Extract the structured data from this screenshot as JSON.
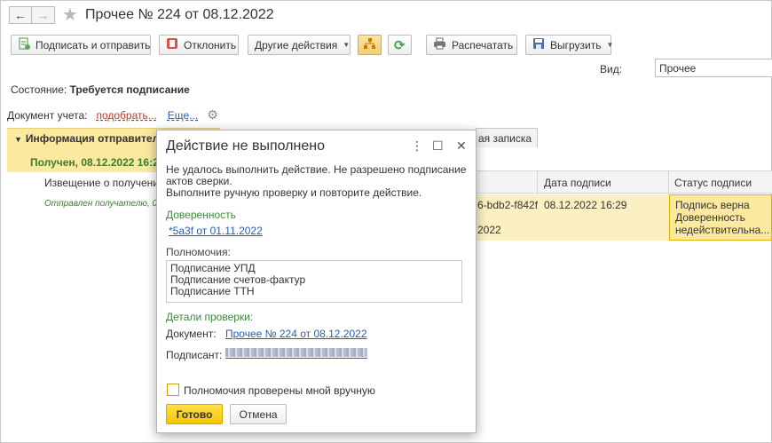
{
  "window": {
    "title": "Прочее № 224 от 08.12.2022",
    "nav_back": "←",
    "nav_forward": "→"
  },
  "toolbar": {
    "sign_send": "Подписать и отправить",
    "reject": "Отклонить",
    "other_actions": "Другие действия",
    "print": "Распечатать",
    "export": "Выгрузить"
  },
  "form": {
    "vid_label": "Вид:",
    "vid_value": "Прочее",
    "state_label": "Состояние:",
    "state_value": "Требуется подписание",
    "doc_uchet_label": "Документ учета:",
    "pick_link": "подобрать...",
    "more_link": "Еще..."
  },
  "left_panel": {
    "info_title": "Информация отправителя",
    "received": "Получен, 08.12.2022 16:29",
    "notice": "Извещение о получении",
    "sent_note": "Отправлен получателю, 08.12.2022"
  },
  "table": {
    "tab_label": "ая записка",
    "headers": [
      "Дата подписи",
      "Статус подписи"
    ],
    "row": {
      "id_fragment_1": "6-bdb2-f842f",
      "id_fragment_2": "2022",
      "date": "08.12.2022 16:29",
      "status": "Подпись верна Доверенность недействительна..."
    }
  },
  "dialog": {
    "title": "Действие не выполнено",
    "message_line1": "Не удалось выполнить действие. Не разрешено подписание",
    "message_line2": "актов сверки.",
    "message_line3": "Выполните ручную проверку и повторите действие.",
    "proxy_section": "Доверенность",
    "proxy_link": "*5a3f от 01.11.2022",
    "permissions_label": "Полномочия:",
    "permissions": [
      "Подписание УПД",
      "Подписание счетов-фактур",
      "Подписание ТТН"
    ],
    "details_section": "Детали проверки:",
    "doc_label": "Документ:",
    "doc_link": "Прочее № 224 от 08.12.2022",
    "signer_label": "Подписант:",
    "checkbox_label": "Полномочия проверены мной вручную",
    "ok_label": "Готово",
    "cancel_label": "Отмена"
  }
}
